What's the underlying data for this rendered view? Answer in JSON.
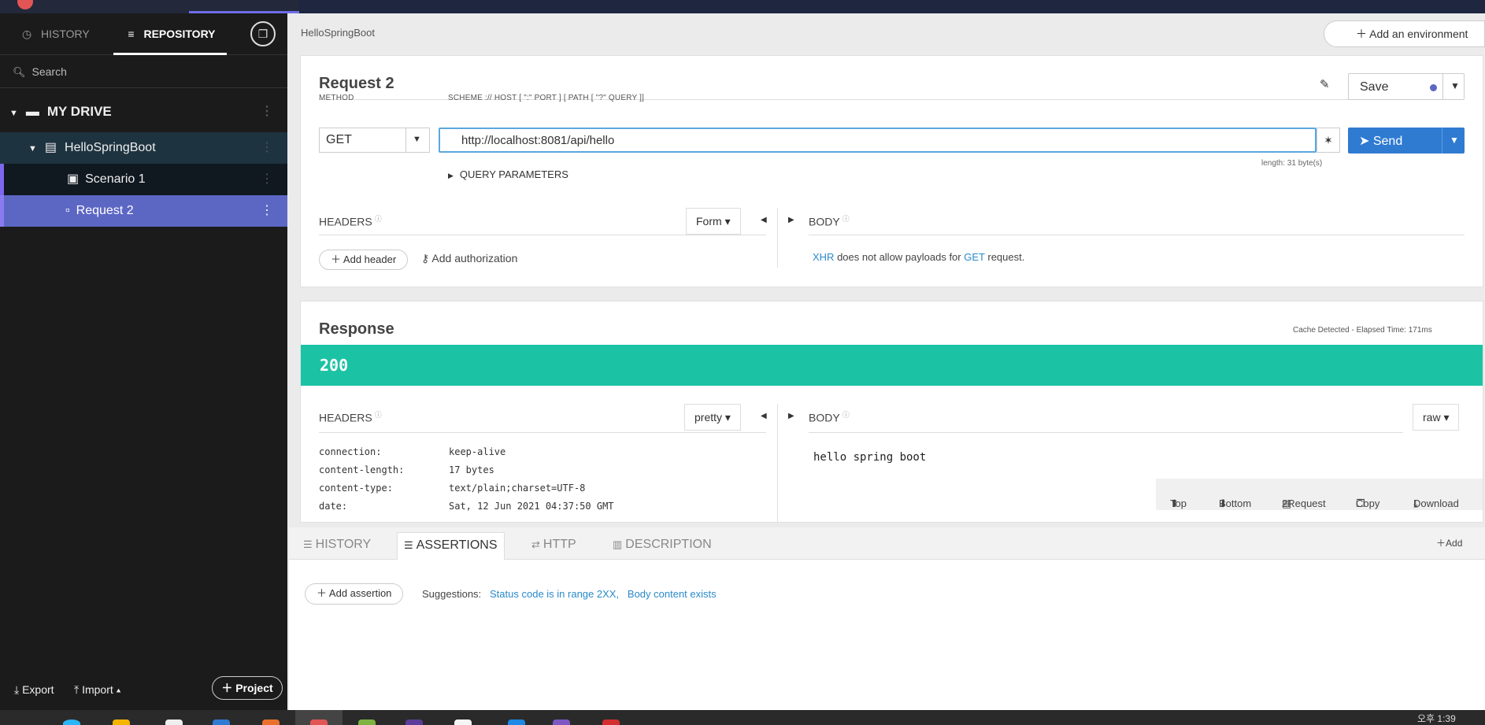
{
  "sidebar": {
    "tabs": {
      "history": "HISTORY",
      "repository": "REPOSITORY"
    },
    "search_placeholder": "Search",
    "drive": "MY DRIVE",
    "project": "HelloSpringBoot",
    "scenario": "Scenario 1",
    "request": "Request 2",
    "export": "Export",
    "import": "Import",
    "project_button": "Project"
  },
  "breadcrumb": "HelloSpringBoot",
  "env_button": "Add an environment",
  "request": {
    "title": "Request 2",
    "save": "Save",
    "method_label": "METHOD",
    "method": "GET",
    "url_label": "SCHEME :// HOST [ \":\" PORT ] [ PATH [ \"?\" QUERY ]]",
    "url": "http://localhost:8081/api/hello",
    "send": "Send",
    "length": "length: 31 byte(s)",
    "query_params": "QUERY PARAMETERS",
    "headers_label": "HEADERS",
    "headers_mode": "Form",
    "body_label": "BODY",
    "add_header": "Add header",
    "add_authorization": "Add authorization",
    "body_msg_xhr": "XHR",
    "body_msg_mid": "does not allow payloads for",
    "body_msg_get": "GET",
    "body_msg_end": "request."
  },
  "response": {
    "title": "Response",
    "cache_info": "Cache Detected - Elapsed Time: 171ms",
    "status": "200",
    "headers_label": "HEADERS",
    "headers_mode": "pretty",
    "body_label": "BODY",
    "body_mode": "raw",
    "headers": [
      {
        "k": "connection:",
        "v": "keep-alive"
      },
      {
        "k": "content-length:",
        "v": "17 bytes"
      },
      {
        "k": "content-type:",
        "v": "text/plain;charset=UTF-8"
      },
      {
        "k": "date:",
        "v": "Sat, 12 Jun 2021 04:37:50 GMT"
      }
    ],
    "body": "hello spring boot",
    "tools": {
      "top": "Top",
      "bottom": "Bottom",
      "to_request": "2Request",
      "copy": "Copy",
      "download": "Download"
    }
  },
  "bottom_panel": {
    "tabs": {
      "history": "HISTORY",
      "assertions": "ASSERTIONS",
      "http": "HTTP",
      "description": "DESCRIPTION"
    },
    "add": "Add",
    "add_assertion": "Add assertion",
    "suggestions_label": "Suggestions:",
    "suggestion_1": "Status code is in range 2XX,",
    "suggestion_2": "Body content exists"
  },
  "taskbar": {
    "time": "오후 1:39"
  },
  "colors": {
    "status_ok": "#1bc3a4",
    "accent": "#5c67c4",
    "send": "#2f7bd2"
  }
}
